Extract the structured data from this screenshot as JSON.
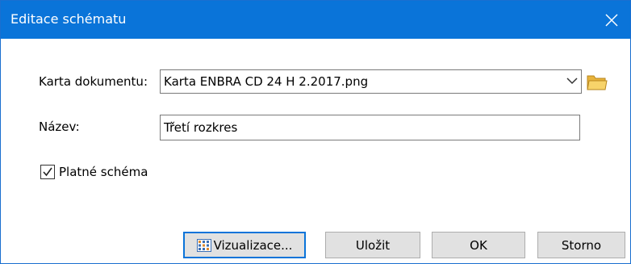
{
  "window": {
    "title": "Editace schématu"
  },
  "form": {
    "card_label": "Karta dokumentu:",
    "card_value": "Karta ENBRA CD 24 H 2.2017.png",
    "name_label": "Název:",
    "name_value": "Třetí rozkres",
    "valid_label": "Platné schéma",
    "valid_checked": true
  },
  "buttons": {
    "visualize": "Vizualizace...",
    "save": "Uložit",
    "ok": "OK",
    "cancel": "Storno"
  },
  "colors": {
    "titlebar": "#0a74d9",
    "button_bg": "#e1e1e1",
    "folder": "#f3c84a"
  }
}
